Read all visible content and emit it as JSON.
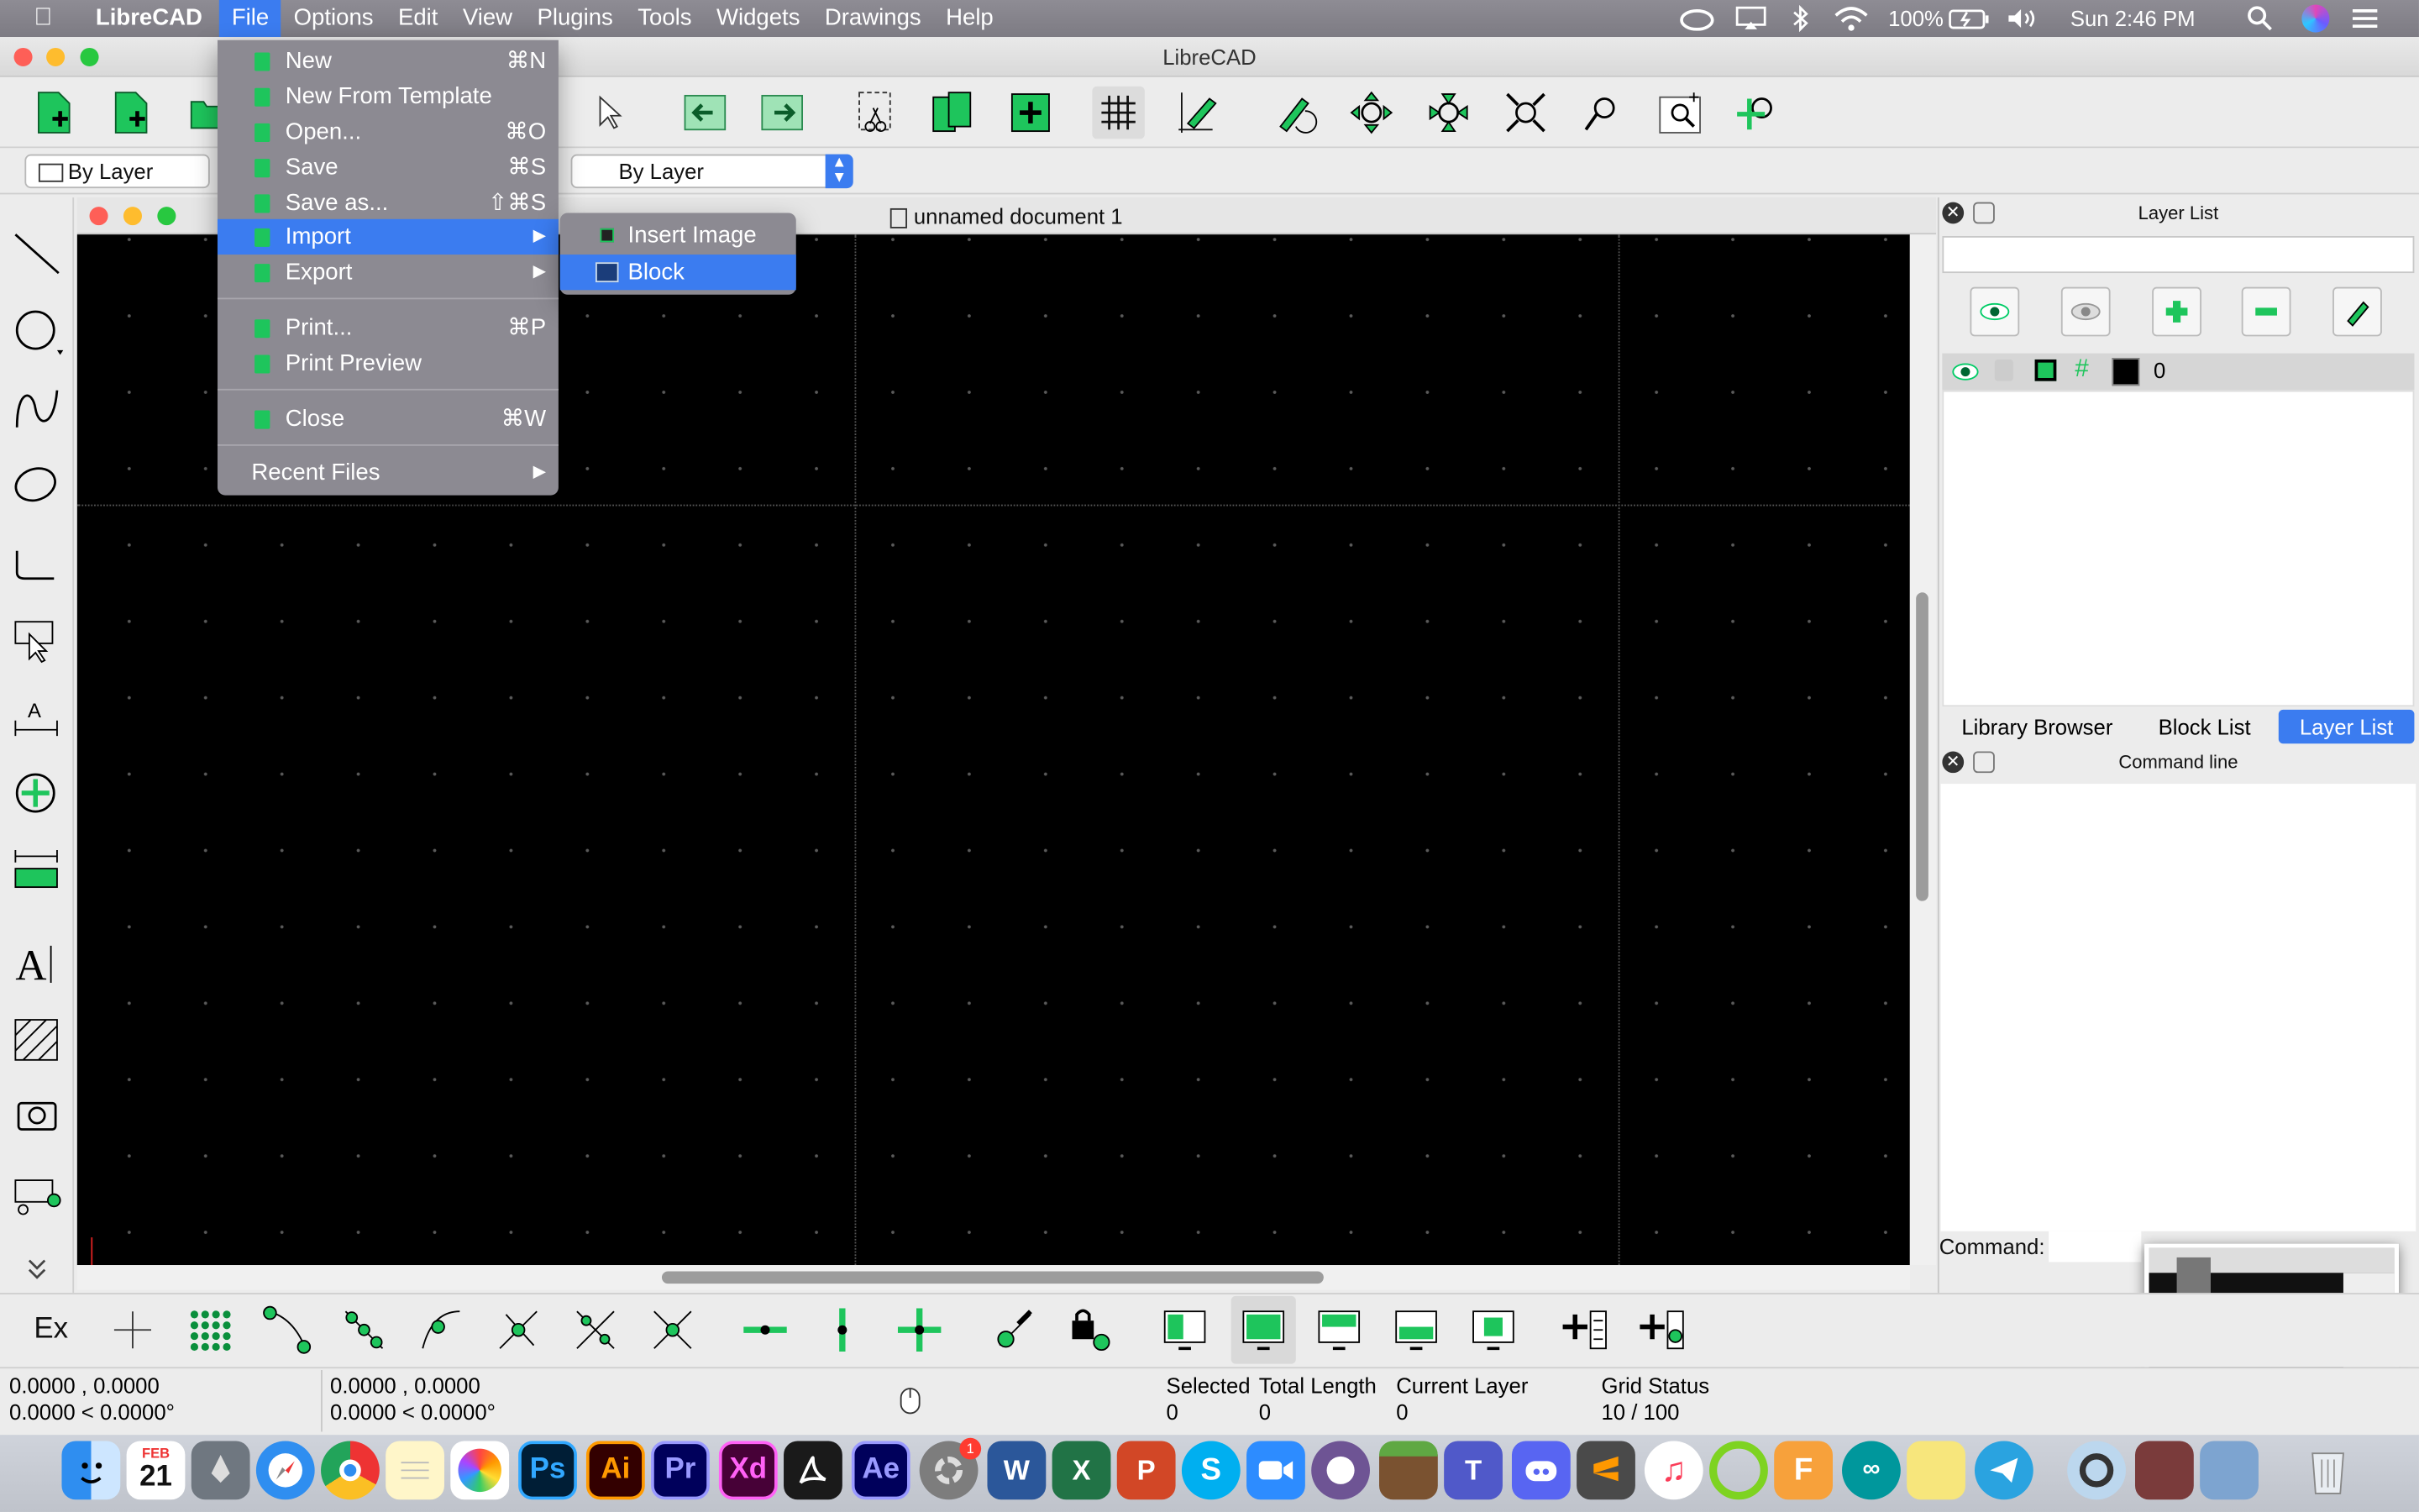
{
  "menubar": {
    "app": "LibreCAD",
    "items": [
      "File",
      "Options",
      "Edit",
      "View",
      "Plugins",
      "Tools",
      "Widgets",
      "Drawings",
      "Help"
    ],
    "battery": "100%",
    "clock": "Sun 2:46 PM"
  },
  "window": {
    "title": "LibreCAD"
  },
  "toolbar2": {
    "pen_combo": "By Layer",
    "layer_combo": "By Layer"
  },
  "document": {
    "title": "unnamed document 1"
  },
  "file_menu": {
    "new": "New",
    "new_sc": "⌘N",
    "new_template": "New From Template",
    "open": "Open...",
    "open_sc": "⌘O",
    "save": "Save",
    "save_sc": "⌘S",
    "save_as": "Save as...",
    "save_as_sc": "⇧⌘S",
    "import": "Import",
    "export": "Export",
    "print": "Print...",
    "print_sc": "⌘P",
    "print_preview": "Print Preview",
    "close": "Close",
    "close_sc": "⌘W",
    "recent": "Recent Files"
  },
  "import_submenu": {
    "insert_image": "Insert Image",
    "block": "Block"
  },
  "layer_panel": {
    "title": "Layer List",
    "layer_name": "0",
    "tabs": [
      "Library Browser",
      "Block List",
      "Layer List"
    ]
  },
  "command_panel": {
    "title": "Command line",
    "prompt": "Command:"
  },
  "bottom_toolbar": {
    "ex_label": "Ex"
  },
  "statusbar": {
    "abs1": "0.0000 , 0.0000",
    "abs2": "0.0000 < 0.0000°",
    "rel1": "0.0000 , 0.0000",
    "rel2": "0.0000 < 0.0000°",
    "selected_label": "Selected",
    "selected_value": "0",
    "length_label": "Total Length",
    "length_value": "0",
    "layer_label": "Current Layer",
    "layer_value": "0",
    "grid_label": "Grid Status",
    "grid_value": "10 / 100"
  },
  "dock": {
    "calendar_month": "FEB",
    "calendar_day": "21",
    "settings_badge": "1",
    "apps": [
      "Ps",
      "Ai",
      "Pr",
      "Xd",
      "Ae"
    ]
  },
  "colors": {
    "accent": "#3b7cf0",
    "tool_green": "#1ec55c",
    "canvas": "#000000"
  }
}
